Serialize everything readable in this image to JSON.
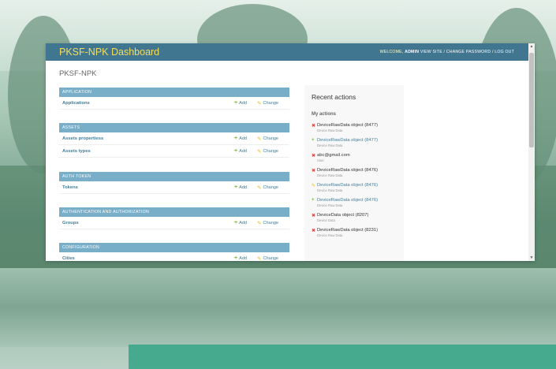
{
  "header": {
    "brand": "PKSF-NPK Dashboard",
    "welcome": "WELCOME,",
    "username": "ADMIN",
    "view_site": "VIEW SITE",
    "change_password": "CHANGE PASSWORD",
    "log_out": "LOG OUT",
    "separator": " / "
  },
  "page_title": "PKSF-NPK",
  "links": {
    "add": "Add",
    "change": "Change"
  },
  "modules": [
    {
      "caption": "APPLICATION",
      "rows": [
        "Applications"
      ]
    },
    {
      "caption": "ASSETS",
      "rows": [
        "Assets propertiess",
        "Assets types"
      ]
    },
    {
      "caption": "AUTH TOKEN",
      "rows": [
        "Tokens"
      ]
    },
    {
      "caption": "AUTHENTICATION AND AUTHORIZATION",
      "rows": [
        "Groups"
      ]
    },
    {
      "caption": "CONFIGURATION",
      "rows": [
        "Cities"
      ]
    }
  ],
  "recent": {
    "title": "Recent actions",
    "subtitle": "My actions",
    "actions": [
      {
        "type": "delete",
        "label": "DeviceRawData object (8477)",
        "sub": "Device Raw Data"
      },
      {
        "type": "add",
        "label": "DeviceRawData object (8477)",
        "sub": "Device Raw Data"
      },
      {
        "type": "delete",
        "label": "abc@gmail.com",
        "sub": "User"
      },
      {
        "type": "delete",
        "label": "DeviceRawData object (8476)",
        "sub": "Device Raw Data"
      },
      {
        "type": "change",
        "label": "DeviceRawData object (8476)",
        "sub": "Device Raw Data"
      },
      {
        "type": "add",
        "label": "DeviceRawData object (8476)",
        "sub": "Device Raw Data"
      },
      {
        "type": "delete",
        "label": "DeviceData object (8207)",
        "sub": "Device Data"
      },
      {
        "type": "delete",
        "label": "DeviceRawData object (8231)",
        "sub": "Device Raw Data"
      }
    ]
  },
  "colors": {
    "header": "#417690",
    "brand": "#f5dd5d",
    "module_caption": "#79aec8",
    "link": "#447e9b",
    "add_icon": "#70bf2b",
    "change_icon": "#efb80b",
    "delete_icon": "#dd4646"
  }
}
